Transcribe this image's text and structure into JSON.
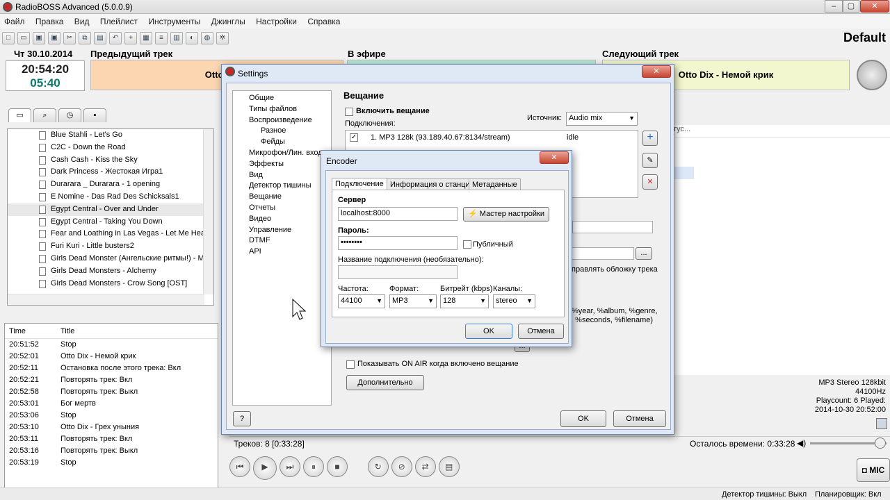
{
  "window": {
    "title": "RadioBOSS Advanced (5.0.0.9)"
  },
  "menu": [
    "Файл",
    "Правка",
    "Вид",
    "Плейлист",
    "Инструменты",
    "Джинглы",
    "Настройки",
    "Справка"
  ],
  "profile": "Default",
  "date": "Чт 30.10.2014",
  "clock": {
    "time": "20:54:20",
    "elapsed": "05:40"
  },
  "panels": {
    "prev_label": "Предыдущий трек",
    "prev_track": "Otto Dix - Грех уныния",
    "onair_label": "В эфире",
    "next_label": "Следующий трек",
    "next_track": "Otto Dix - Немой крик"
  },
  "library": [
    "Blue Stahli - Let's Go",
    "C2C - Down the Road",
    "Cash Cash - Kiss the Sky",
    "Dark Princess - Жестокая Игра1",
    "Durarara _ Durarara - 1 opening",
    "E Nomine - Das Rad Des Schicksals1",
    "Egypt Central - Over and Under",
    "Egypt Central - Taking You Down",
    "Fear and Loathing in Las Vegas - Let Me Hear (",
    "Furi Kuri - Little busters2",
    "Girls Dead Monster (Ангельские ритмы!) - My S",
    "Girls Dead Monsters - Alchemy",
    "Girls Dead Monsters - Crow Song [OST]"
  ],
  "log": {
    "col_time": "Time",
    "col_title": "Title",
    "rows": [
      [
        "20:51:52",
        "Stop"
      ],
      [
        "20:52:01",
        "Otto Dix - Немой крик"
      ],
      [
        "20:52:11",
        "Остановка после этого трека: Вкл"
      ],
      [
        "20:52:21",
        "Повторять трек: Вкл"
      ],
      [
        "20:52:58",
        "Повторять трек: Выкл"
      ],
      [
        "20:53:01",
        "Бог мертв"
      ],
      [
        "20:53:06",
        "Stop"
      ],
      [
        "20:53:10",
        "Otto Dix - Грех уныния"
      ],
      [
        "20:53:11",
        "Повторять трек: Вкл"
      ],
      [
        "20:53:16",
        "Повторять трек: Выкл"
      ],
      [
        "20:53:19",
        "Stop"
      ]
    ]
  },
  "trackinfo": {
    "format": "MP3 Stereo 128kbit",
    "rate": "44100Hz",
    "playcount": "Playcount: 6 Played:",
    "played": "2014-10-30 20:52:00"
  },
  "bottom": {
    "tracks": "Треков: 8 [0:33:28]",
    "remaining": "Осталось времени: 0:33:28",
    "mic": "MIC",
    "silence": "Детектор тишины: Выкл",
    "scheduler": "Планировщик: Вкл"
  },
  "settings": {
    "title": "Settings",
    "tree": [
      "Общие",
      "Типы файлов",
      "Воспроизведение",
      "Разное",
      "Фейды",
      "Микрофон/Лин. вход",
      "Эффекты",
      "Вид",
      "Детектор тишины",
      "Вещание",
      "Отчеты",
      "Видео",
      "Управление",
      "DTMF",
      "API"
    ],
    "section": "Вещание",
    "enable": "Включить вещание",
    "connections": "Подключения:",
    "source_label": "Источник:",
    "source": "Audio mix",
    "conn_row": "1. MP3 128k (93.189.40.67:8134/stream)",
    "conn_state": "idle",
    "cover": "правлять обложку трека",
    "tags": "%year, %album, %genre,",
    "tags2": "t, %seconds, %filename)",
    "onair": "Показывать ON AIR когда включено вещание",
    "advanced": "Дополнительно",
    "help": "?",
    "ok": "OK",
    "cancel": "Отмена",
    "col_header": "тус..."
  },
  "encoder": {
    "title": "Encoder",
    "tabs": [
      "Подключение",
      "Информация о станции",
      "Метаданные"
    ],
    "server_label": "Сервер",
    "server": "localhost:8000",
    "wizard": "Мастер настройки",
    "password_label": "Пароль:",
    "password": "••••••••",
    "public": "Публичный",
    "name_label": "Название подключения (необязательно):",
    "freq_label": "Частота:",
    "freq": "44100",
    "format_label": "Формат:",
    "format": "MP3",
    "bitrate_label": "Битрейт (kbps)",
    "bitrate": "128",
    "channels_label": "Каналы:",
    "channels": "stereo",
    "ok": "OK",
    "cancel": "Отмена"
  },
  "colors": {
    "prev": "#fbd6b0",
    "onair": "#b7ead7",
    "next": "#f3f7cf",
    "accent": "#0a7a6a"
  }
}
